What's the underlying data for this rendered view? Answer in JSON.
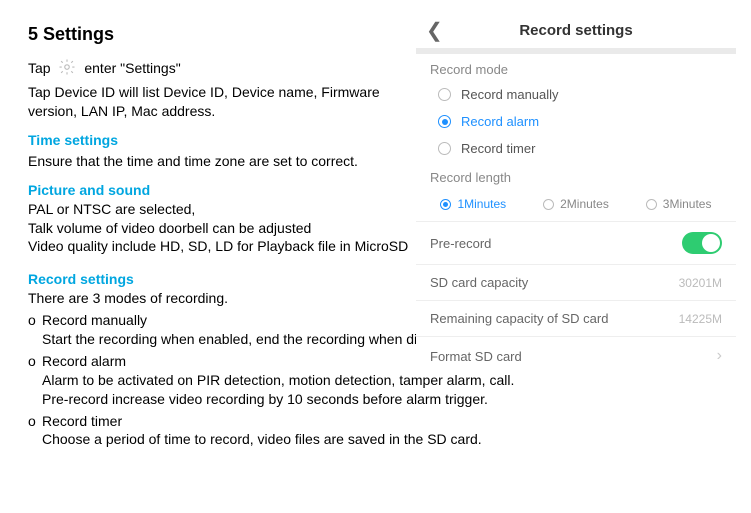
{
  "doc": {
    "section_title": "5  Settings",
    "tap_prefix": "Tap ",
    "tap_suffix": " enter \"Settings\"",
    "device_id_para": "Tap Device ID will list Device ID, Device name, Firmware version, LAN IP, Mac address.",
    "time_head": "Time settings",
    "time_body": "Ensure that the time and time zone are set to correct.",
    "picsound_head": "Picture and sound",
    "picsound_l1": "PAL or NTSC are selected,",
    "picsound_l2": "Talk volume of video doorbell can be adjusted",
    "picsound_l3": "Video quality include HD, SD, LD for Playback file in MicroSD",
    "rec_head": "Record settings",
    "rec_intro": "There are 3 modes of recording.",
    "rec_items": [
      {
        "title": "Record manually",
        "desc": "Start the recording when enabled, end the recording when disabled."
      },
      {
        "title": "Record alarm",
        "desc1": "Alarm to be activated on PIR detection, motion detection, tamper alarm, call.",
        "desc2": "Pre-record increase video recording by 10 seconds before alarm trigger."
      },
      {
        "title": "Record timer",
        "desc": "Choose a period of time to record, video files are saved in the SD card."
      }
    ]
  },
  "phone": {
    "title": "Record settings",
    "mode_label": "Record mode",
    "modes": [
      {
        "label": "Record manually",
        "selected": false
      },
      {
        "label": "Record alarm",
        "selected": true
      },
      {
        "label": "Record timer",
        "selected": false
      }
    ],
    "length_label": "Record length",
    "lengths": [
      {
        "label": "1Minutes",
        "selected": true
      },
      {
        "label": "2Minutes",
        "selected": false
      },
      {
        "label": "3Minutes",
        "selected": false
      }
    ],
    "prerecord_label": "Pre-record",
    "prerecord_on": true,
    "sd_capacity_label": "SD card capacity",
    "sd_capacity_value": "30201M",
    "sd_remaining_label": "Remaining capacity of SD card",
    "sd_remaining_value": "14225M",
    "format_label": "Format SD card"
  }
}
